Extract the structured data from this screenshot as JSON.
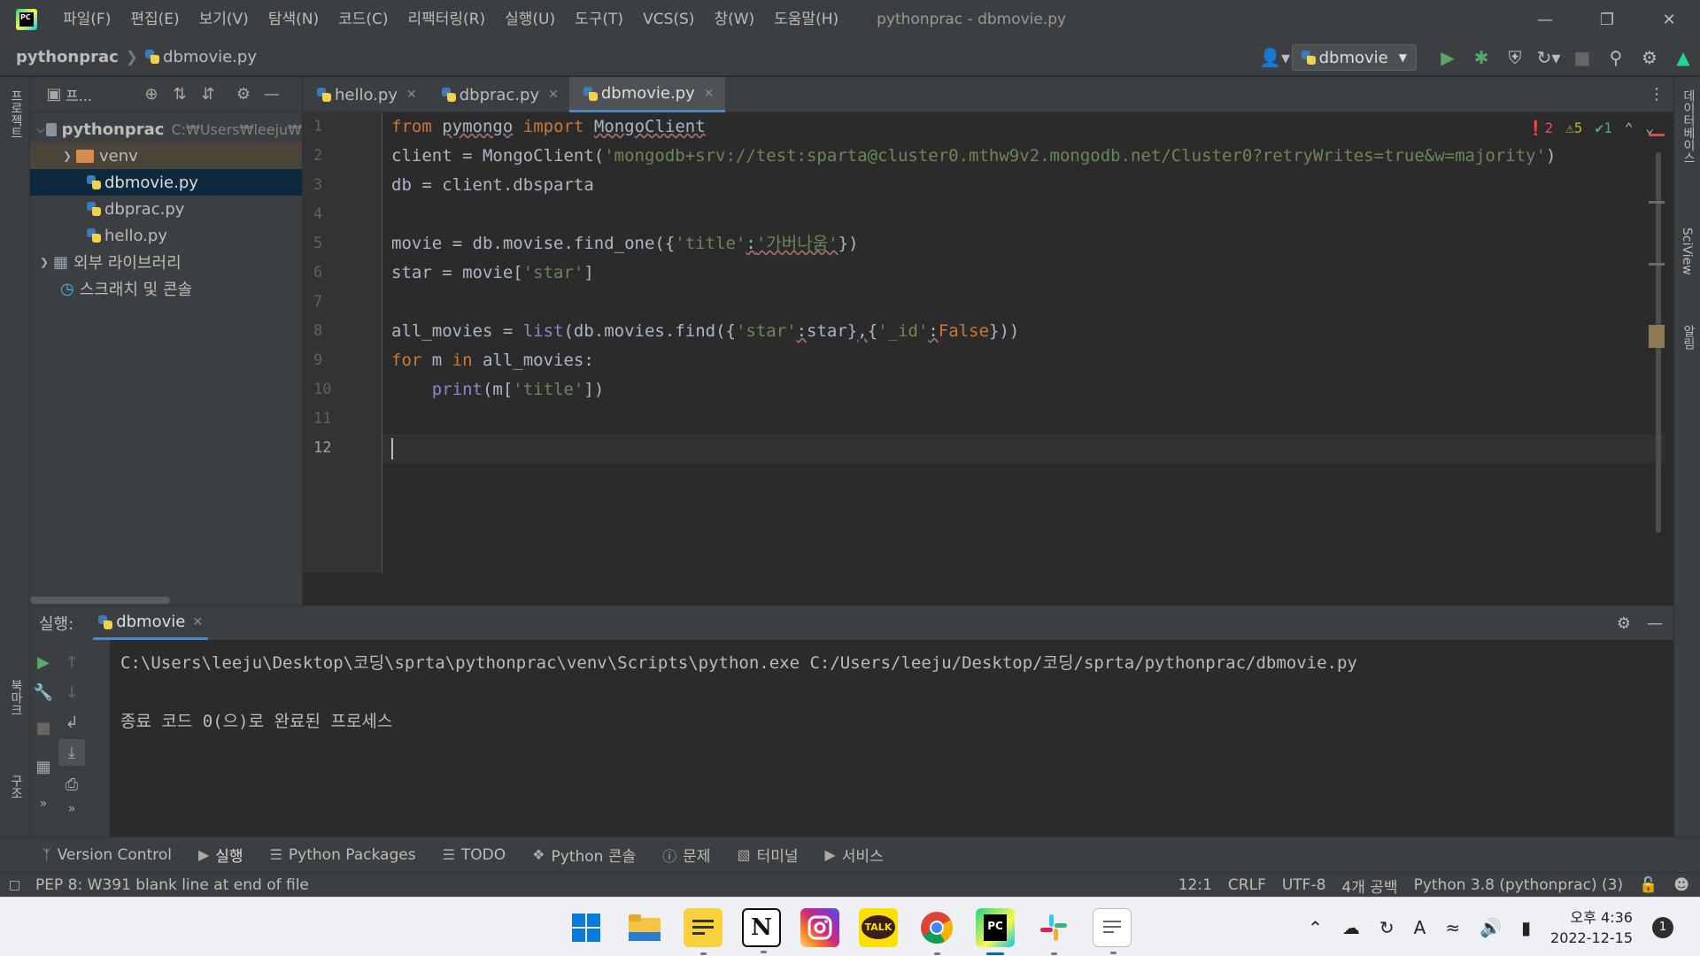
{
  "titlebar": {
    "menu": [
      {
        "label": "파일(F)"
      },
      {
        "label": "편집(E)"
      },
      {
        "label": "보기(V)"
      },
      {
        "label": "탐색(N)"
      },
      {
        "label": "코드(C)"
      },
      {
        "label": "리팩터링(R)"
      },
      {
        "label": "실행(U)"
      },
      {
        "label": "도구(T)"
      },
      {
        "label": "VCS(S)"
      },
      {
        "label": "창(W)"
      },
      {
        "label": "도움말(H)"
      }
    ],
    "window_title": "pythonprac - dbmovie.py"
  },
  "navbar": {
    "project": "pythonprac",
    "file": "dbmovie.py",
    "run_config": "dbmovie"
  },
  "left_stripe": {
    "project_label": "프로젝트",
    "bookmarks_label": "북마크",
    "structure_label": "구조"
  },
  "right_stripe": {
    "database_label": "데이터베이스",
    "sciview_label": "SciView",
    "notifications_label": "알림"
  },
  "project_panel": {
    "title": "프...",
    "tree": {
      "root": "pythonprac",
      "root_path": "C:₩Users₩leeju₩",
      "venv": "venv",
      "files": [
        "dbmovie.py",
        "dbprac.py",
        "hello.py"
      ],
      "external_libs": "외부 라이브러리",
      "scratches": "스크래치 및 콘솔"
    }
  },
  "editor": {
    "tabs": [
      {
        "label": "hello.py"
      },
      {
        "label": "dbprac.py"
      },
      {
        "label": "dbmovie.py"
      }
    ],
    "inspections": {
      "errors": "2",
      "warnings": "5",
      "typos": "1"
    },
    "line_numbers": [
      "1",
      "2",
      "3",
      "4",
      "5",
      "6",
      "7",
      "8",
      "9",
      "10",
      "11",
      "12"
    ],
    "code": {
      "l1_from": "from",
      "l1_mod": "pymongo",
      "l1_import": "import",
      "l1_cls": "MongoClient",
      "l2_pre": "client = MongoClient(",
      "l2_str": "'mongodb+srv://test:sparta@cluster0.mthw9v2.mongodb.net/Cluster0?retryWrites=true&w=majority'",
      "l2_post": ")",
      "l3": "db = client.dbsparta",
      "l5_pre": "movie = db.movise.find_one({",
      "l5_k": "'title'",
      "l5_colon": ":",
      "l5_v": "'가버나움'",
      "l5_post": "})",
      "l6_pre": "star = movie[",
      "l6_k": "'star'",
      "l6_post": "]",
      "l8_pre": "all_movies = ",
      "l8_list": "list",
      "l8_mid": "(db.movies.find({",
      "l8_k1": "'star'",
      "l8_c1": ":",
      "l8_v1": "star}",
      "l8_comma": ",",
      "l8_ob": "{",
      "l8_k2": "'_id'",
      "l8_c2": ":",
      "l8_v2": "False",
      "l8_post": "}))",
      "l9_for": "for",
      "l9_m": " m ",
      "l9_in": "in",
      "l9_post": " all_movies:",
      "l10_indent": "    ",
      "l10_print": "print",
      "l10_pre": "(m[",
      "l10_k": "'title'",
      "l10_post": "])"
    }
  },
  "run_panel": {
    "label": "실행:",
    "tab": "dbmovie",
    "console": {
      "command": "C:\\Users\\leeju\\Desktop\\코딩\\sprta\\pythonprac\\venv\\Scripts\\python.exe C:/Users/leeju/Desktop/코딩/sprta/pythonprac/dbmovie.py",
      "exit": "종료 코드 0(으)로 완료된 프로세스"
    }
  },
  "tool_windows": [
    {
      "label": "Version Control"
    },
    {
      "label": "실행"
    },
    {
      "label": "Python Packages"
    },
    {
      "label": "TODO"
    },
    {
      "label": "Python 콘솔"
    },
    {
      "label": "문제"
    },
    {
      "label": "터미널"
    },
    {
      "label": "서비스"
    }
  ],
  "statusbar": {
    "message": "PEP 8: W391 blank line at end of file",
    "position": "12:1",
    "line_sep": "CRLF",
    "encoding": "UTF-8",
    "indent": "4개 공백",
    "interpreter": "Python 3.8 (pythonprac) (3)"
  },
  "taskbar": {
    "time": "오후 4:36",
    "date": "2022-12-15",
    "notifications": "1",
    "ime": "A",
    "app_labels": {
      "notion": "N",
      "kakaotalk": "TALK",
      "pycharm": "PC"
    }
  }
}
